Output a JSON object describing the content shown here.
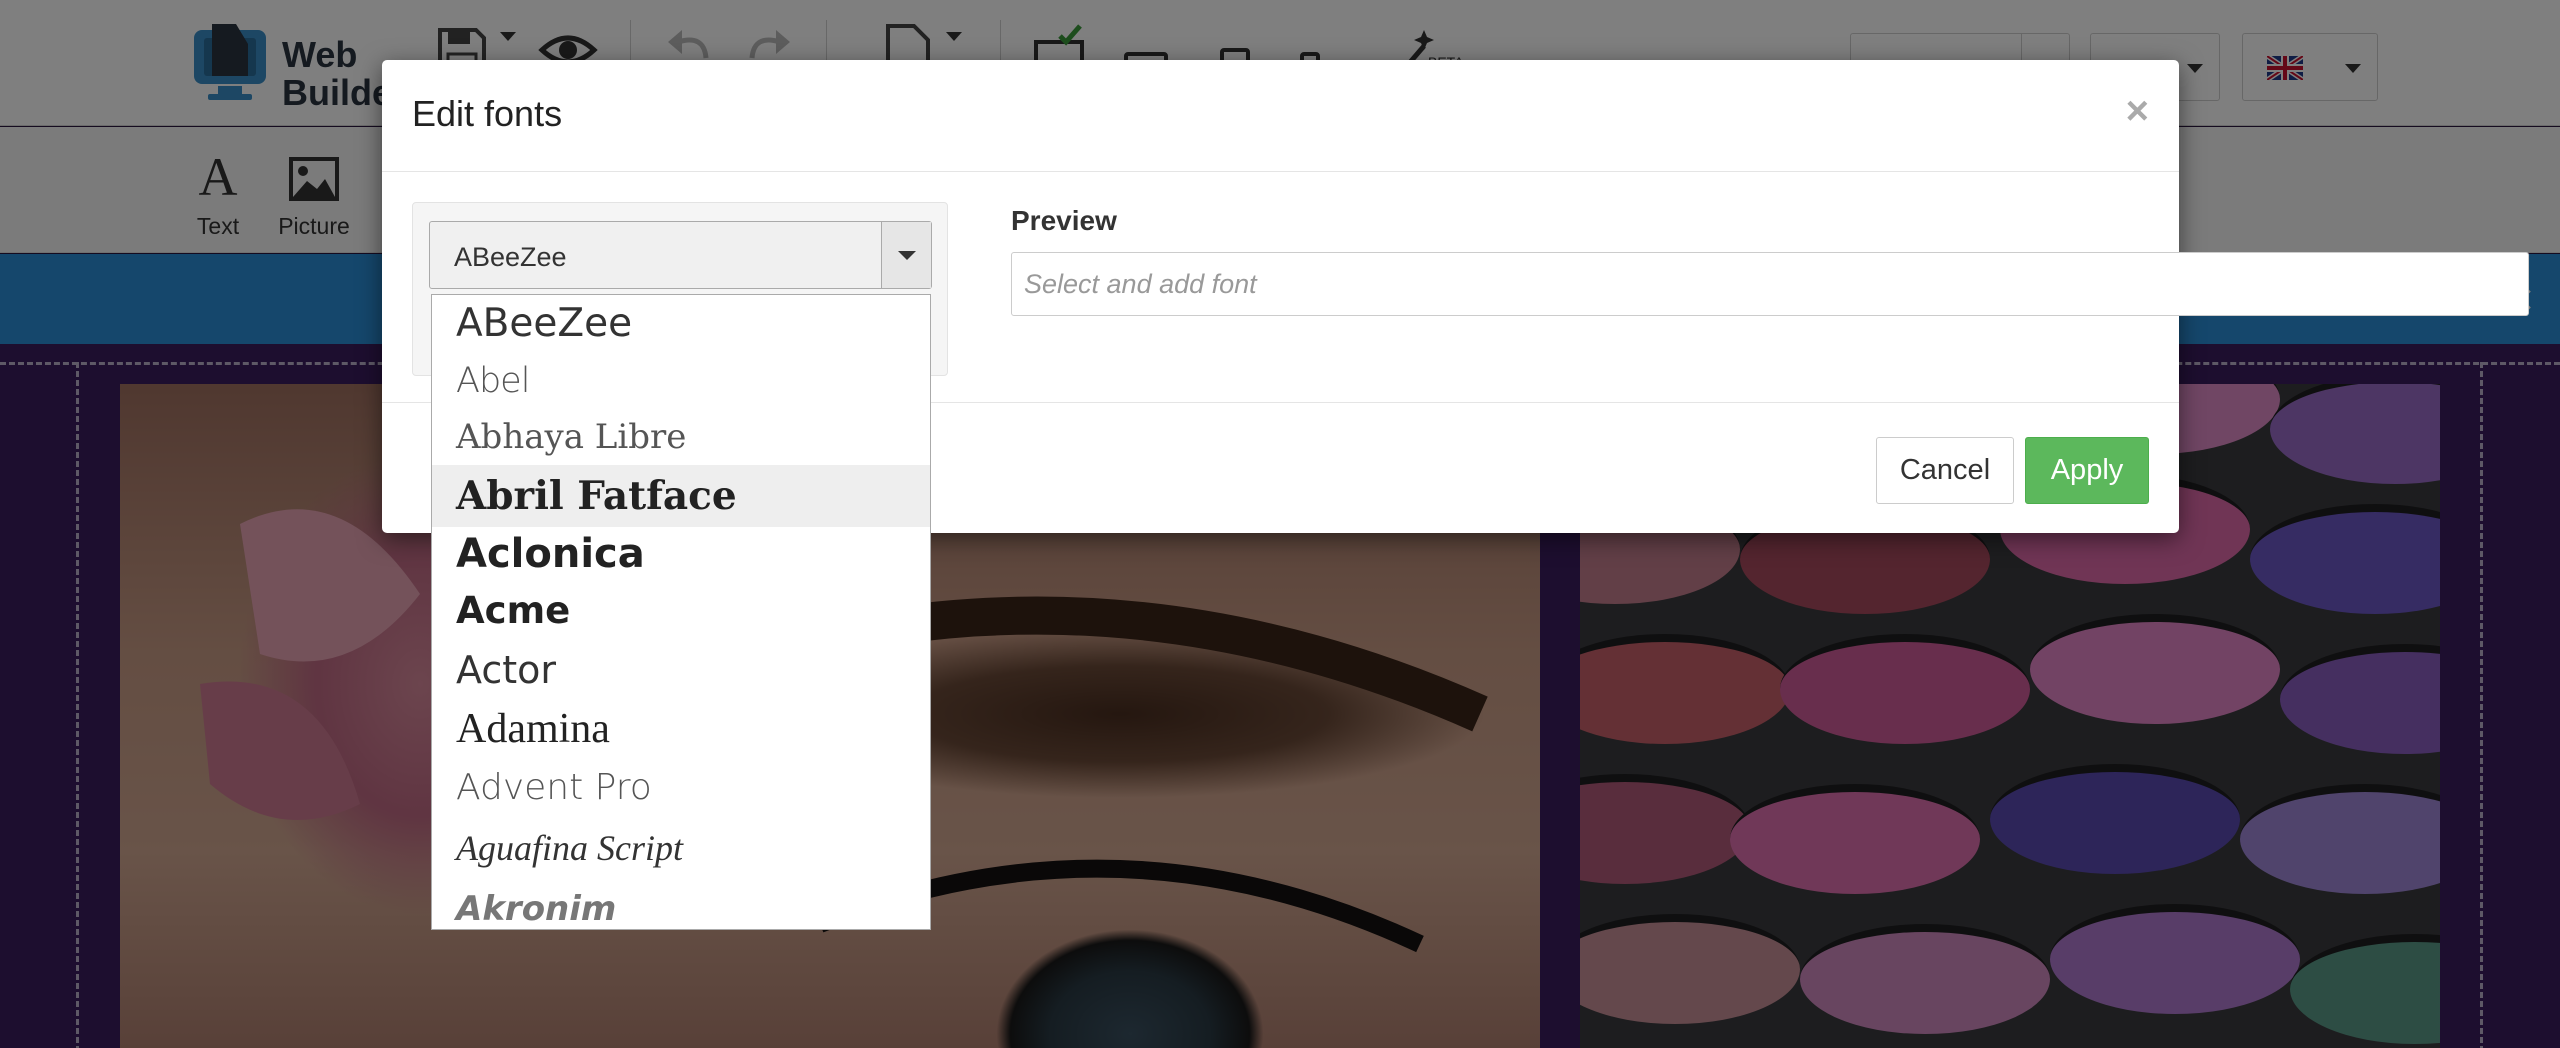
{
  "app": {
    "logo_line1": "Web",
    "logo_line2": "Builder"
  },
  "toolbar": {
    "icons": [
      "save-icon",
      "preview-eye-icon",
      "undo-icon",
      "redo-icon",
      "page-icon",
      "desktop-icon",
      "tablet-landscape-icon",
      "tablet-portrait-icon",
      "phone-icon",
      "magic-wand-icon"
    ],
    "beta_label": "BETA",
    "language_flag": "uk-flag-icon"
  },
  "tools": [
    {
      "label": "Text",
      "icon": "text-icon"
    },
    {
      "label": "Picture",
      "icon": "picture-icon"
    }
  ],
  "modal": {
    "title": "Edit fonts",
    "close_label": "×",
    "selected_font": "ABeeZee",
    "preview_label": "Preview",
    "preview_placeholder": "Select and add font",
    "cancel_label": "Cancel",
    "apply_label": "Apply"
  },
  "font_options": [
    {
      "label": "ABeeZee"
    },
    {
      "label": "Abel"
    },
    {
      "label": "Abhaya Libre"
    },
    {
      "label": "Abril Fatface"
    },
    {
      "label": "Aclonica"
    },
    {
      "label": "Acme"
    },
    {
      "label": "Actor"
    },
    {
      "label": "Adamina"
    },
    {
      "label": "Advent Pro"
    },
    {
      "label": "Aguafina Script"
    },
    {
      "label": "Akronim"
    }
  ],
  "infobar": {
    "close_label": "×"
  },
  "colors": {
    "infobar": "#2b8fd8",
    "apply_button": "#5cb85c",
    "canvas": "#3a1d5e"
  }
}
